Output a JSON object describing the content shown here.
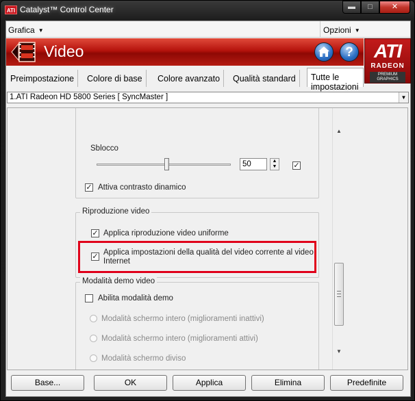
{
  "window": {
    "title": "Catalyst™ Control Center",
    "app_badge": "ATI",
    "minimize_glyph": "▬",
    "maximize_glyph": "□",
    "close_glyph": "✕"
  },
  "menu": {
    "grafica": "Grafica",
    "opzioni": "Opzioni"
  },
  "banner": {
    "title": "Video",
    "help_glyph": "?"
  },
  "logo": {
    "ati": "ATI",
    "radeon": "RADEON",
    "premium": "PREMIUM GRAPHICS"
  },
  "tabs": [
    {
      "label": "Preimpostazione",
      "active": false
    },
    {
      "label": "Colore di base",
      "active": false
    },
    {
      "label": "Colore avanzato",
      "active": false
    },
    {
      "label": "Qualità standard",
      "active": false
    },
    {
      "label": "Tutte le impostazioni",
      "active": true
    }
  ],
  "device": {
    "selected": "1.ATI Radeon HD 5800 Series [ SyncMaster ]"
  },
  "settings": {
    "sblocco": {
      "label": "Sblocco",
      "value": "50",
      "checked": true
    },
    "contrast": {
      "label": "Attiva contrasto dinamico",
      "checked": true
    },
    "playback": {
      "title": "Riproduzione video",
      "smooth": {
        "label": "Applica riproduzione video uniforme",
        "checked": true
      },
      "internet": {
        "label_line1": "Applica impostazioni della qualità del video corrente al video",
        "label_line2": "Internet",
        "checked": true
      }
    },
    "demo": {
      "title": "Modalità demo video",
      "enable": {
        "label": "Abilita modalità demo",
        "checked": false
      },
      "options": [
        "Modalità schermo intero (miglioramenti inattivi)",
        "Modalità schermo intero (miglioramenti attivi)",
        "Modalità schermo diviso"
      ]
    }
  },
  "buttons": {
    "base": "Base...",
    "ok": "OK",
    "applica": "Applica",
    "elimina": "Elimina",
    "predefinite": "Predefinite"
  },
  "colors": {
    "highlight": "#e0001a",
    "banner_red": "#b5120c",
    "ati_red": "#c21b1b"
  }
}
